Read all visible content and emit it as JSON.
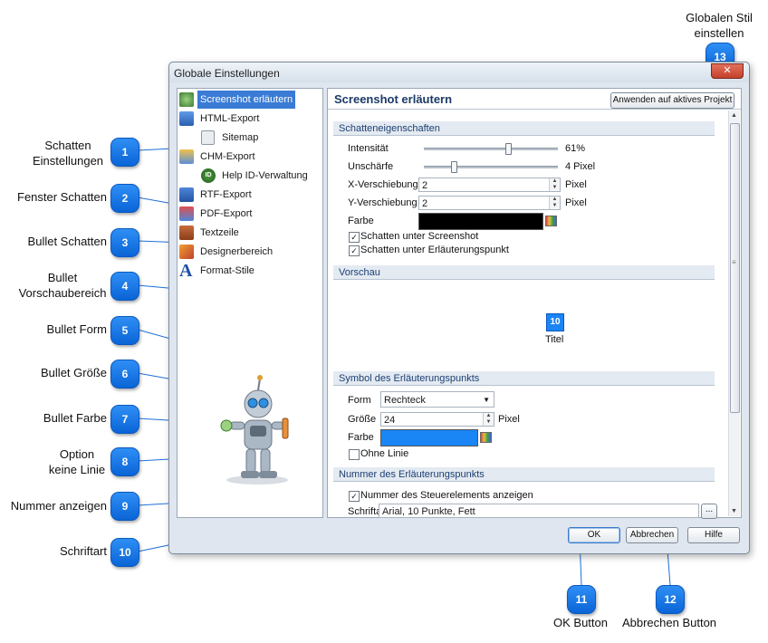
{
  "window": {
    "title": "Globale Einstellungen",
    "close_label": "✕"
  },
  "tree": {
    "items": [
      {
        "label": "Screenshot erläutern",
        "icon": "screenshot-gear-icon"
      },
      {
        "label": "HTML-Export",
        "icon": "html-export-icon"
      },
      {
        "label": "Sitemap",
        "icon": "sitemap-icon"
      },
      {
        "label": "CHM-Export",
        "icon": "chm-export-icon"
      },
      {
        "label": "Help ID-Verwaltung",
        "icon": "help-id-icon"
      },
      {
        "label": "RTF-Export",
        "icon": "rtf-export-icon"
      },
      {
        "label": "PDF-Export",
        "icon": "pdf-export-icon"
      },
      {
        "label": "Textzeile",
        "icon": "text-line-icon"
      },
      {
        "label": "Designerbereich",
        "icon": "designer-icon"
      },
      {
        "label": "Format-Stile",
        "icon": "format-styles-icon"
      }
    ],
    "id_badge": "ID"
  },
  "panel": {
    "title": "Screenshot erläutern",
    "apply_button": "Anwenden auf aktives Projekt",
    "shadow_section": "Schatteneigenschaften",
    "intensity_label": "Intensität",
    "intensity_value": "61%",
    "intensity_fraction": 0.61,
    "blur_label": "Unschärfe",
    "blur_value": "4 Pixel",
    "blur_fraction": 0.2,
    "xoffset_label": "X-Verschiebung",
    "xoffset_value": "2",
    "yoffset_label": "Y-Verschiebung",
    "yoffset_value": "2",
    "pixel_unit": "Pixel",
    "color_label": "Farbe",
    "shadow_color": "#000000",
    "shadow_screenshot_label": "Schatten unter Screenshot",
    "shadow_bullet_label": "Schatten unter Erläuterungspunkt",
    "preview_section": "Vorschau",
    "preview_bullet_number": "10",
    "preview_bullet_caption": "Titel",
    "bullet_section": "Symbol des Erläuterungspunkts",
    "form_label": "Form",
    "form_value": "Rechteck",
    "size_label": "Größe",
    "size_value": "24",
    "bullet_color_label": "Farbe",
    "bullet_color": "#1a85f5",
    "no_line_label": "Ohne Linie",
    "number_section": "Nummer des Erläuterungspunkts",
    "show_number_label": "Nummer des Steuerelements anzeigen",
    "font_label": "Schriftart",
    "font_value": "Arial, 10 Punkte, Fett",
    "font_browse": "...",
    "check_mark": "✓",
    "scroll_up": "▲",
    "scroll_down": "▼",
    "spin_up": "▲",
    "spin_down": "▼",
    "dropdown_arrow": "▼",
    "scroll_grip": "≡"
  },
  "buttons": {
    "ok": "OK",
    "cancel": "Abbrechen",
    "help": "Hilfe"
  },
  "callouts": [
    {
      "n": "1",
      "text1": "Schatten",
      "text2": "Einstellungen"
    },
    {
      "n": "2",
      "text1": "Fenster Schatten"
    },
    {
      "n": "3",
      "text1": "Bullet Schatten"
    },
    {
      "n": "4",
      "text1": "Bullet",
      "text2": "Vorschaubereich"
    },
    {
      "n": "5",
      "text1": "Bullet Form"
    },
    {
      "n": "6",
      "text1": "Bullet Größe"
    },
    {
      "n": "7",
      "text1": "Bullet Farbe"
    },
    {
      "n": "8",
      "text1": "Option",
      "text2": "keine Linie"
    },
    {
      "n": "9",
      "text1": "Nummer anzeigen"
    },
    {
      "n": "10",
      "text1": "Schriftart"
    },
    {
      "n": "11",
      "text1": "OK Button"
    },
    {
      "n": "12",
      "text1": "Abbrechen Button"
    },
    {
      "n": "13",
      "text1": "Globalen Stil",
      "text2": "einstellen"
    }
  ],
  "colors": {
    "accent": "#0a64d6",
    "selection": "#3a7bd5",
    "section_header_bg": "#e4eaf1"
  }
}
